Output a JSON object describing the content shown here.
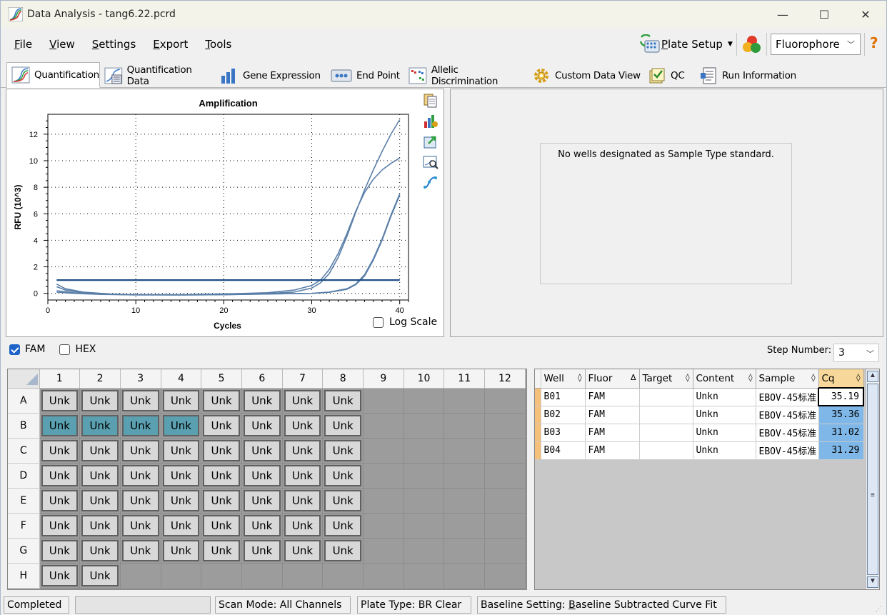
{
  "window": {
    "title": "Data Analysis - tang6.22.pcrd",
    "minimize": "—",
    "maximize": "☐",
    "close": "✕"
  },
  "menu": [
    {
      "pre": "",
      "u": "F",
      "post": "ile"
    },
    {
      "pre": "",
      "u": "V",
      "post": "iew"
    },
    {
      "pre": "",
      "u": "S",
      "post": "ettings"
    },
    {
      "pre": "",
      "u": "E",
      "post": "xport"
    },
    {
      "pre": "",
      "u": "T",
      "post": "ools"
    }
  ],
  "toolbar": {
    "plate_setup_u": "P",
    "plate_setup_rest": "late Setup",
    "fluor_select": "Fluorophore",
    "help": "?"
  },
  "tabs": [
    {
      "label": "Quantification",
      "icon": "amplification-icon"
    },
    {
      "label": "Quantification Data",
      "icon": "quant-data-icon"
    },
    {
      "label": "Gene Expression",
      "icon": "bar-chart-icon"
    },
    {
      "label": "End Point",
      "icon": "end-point-icon"
    },
    {
      "label": "Allelic Discrimination",
      "icon": "scatter-icon"
    },
    {
      "label": "Custom Data View",
      "icon": "gear-icon"
    },
    {
      "label": "QC",
      "icon": "qc-check-icon"
    },
    {
      "label": "Run Information",
      "icon": "report-icon"
    }
  ],
  "chart_data": {
    "type": "line",
    "title": "Amplification",
    "xlabel": "Cycles",
    "ylabel": "RFU (10^3)",
    "xlim": [
      0,
      41
    ],
    "ylim": [
      -0.5,
      13.5
    ],
    "xticks": [
      0,
      10,
      20,
      30,
      40
    ],
    "yticks": [
      0,
      2,
      4,
      6,
      8,
      10,
      12
    ],
    "grid": true,
    "threshold": 1.0,
    "series": [
      {
        "values": [
          [
            1,
            0.2
          ],
          [
            3,
            0.05
          ],
          [
            6,
            -0.05
          ],
          [
            10,
            -0.1
          ],
          [
            15,
            -0.1
          ],
          [
            20,
            -0.05
          ],
          [
            25,
            0.05
          ],
          [
            28,
            0.25
          ],
          [
            30,
            0.6
          ],
          [
            31,
            1.0
          ],
          [
            32,
            1.8
          ],
          [
            33,
            3.0
          ],
          [
            34,
            4.5
          ],
          [
            35,
            6.2
          ],
          [
            36,
            7.6
          ],
          [
            37,
            8.6
          ],
          [
            38,
            9.3
          ],
          [
            39,
            9.8
          ],
          [
            40,
            10.2
          ]
        ]
      },
      {
        "values": [
          [
            1,
            0.1
          ],
          [
            3,
            0.0
          ],
          [
            6,
            -0.08
          ],
          [
            10,
            -0.1
          ],
          [
            15,
            -0.1
          ],
          [
            20,
            -0.05
          ],
          [
            25,
            0.0
          ],
          [
            28,
            0.1
          ],
          [
            30,
            0.4
          ],
          [
            31,
            0.8
          ],
          [
            32,
            1.5
          ],
          [
            33,
            2.7
          ],
          [
            34,
            4.3
          ],
          [
            35,
            6.1
          ],
          [
            36,
            7.8
          ],
          [
            37,
            9.3
          ],
          [
            38,
            10.7
          ],
          [
            39,
            12.0
          ],
          [
            40,
            13.1
          ]
        ]
      },
      {
        "values": [
          [
            1,
            0.7
          ],
          [
            2,
            0.35
          ],
          [
            4,
            0.1
          ],
          [
            7,
            -0.05
          ],
          [
            10,
            -0.1
          ],
          [
            15,
            -0.12
          ],
          [
            20,
            -0.1
          ],
          [
            25,
            -0.05
          ],
          [
            30,
            0.0
          ],
          [
            32,
            0.1
          ],
          [
            34,
            0.35
          ],
          [
            35,
            0.7
          ],
          [
            36,
            1.4
          ],
          [
            37,
            2.6
          ],
          [
            38,
            4.1
          ],
          [
            39,
            5.9
          ],
          [
            40,
            7.5
          ]
        ]
      },
      {
        "values": [
          [
            1,
            0.5
          ],
          [
            2,
            0.25
          ],
          [
            4,
            0.05
          ],
          [
            7,
            -0.08
          ],
          [
            10,
            -0.12
          ],
          [
            15,
            -0.12
          ],
          [
            20,
            -0.1
          ],
          [
            25,
            -0.05
          ],
          [
            30,
            0.0
          ],
          [
            32,
            0.08
          ],
          [
            34,
            0.3
          ],
          [
            35,
            0.65
          ],
          [
            36,
            1.3
          ],
          [
            37,
            2.5
          ],
          [
            38,
            4.0
          ],
          [
            39,
            5.8
          ],
          [
            40,
            7.4
          ]
        ]
      }
    ],
    "line_color": "#5a7fa8",
    "threshold_color": "#1e4e84"
  },
  "chart_options": {
    "log_scale": "Log Scale"
  },
  "std_panel": {
    "message": "No wells designated as Sample Type standard."
  },
  "fluor_filters": [
    {
      "label": "FAM",
      "checked": true
    },
    {
      "label": "HEX",
      "checked": false
    }
  ],
  "step": {
    "label": "Step Number:",
    "value": "3"
  },
  "plate": {
    "cols": [
      "1",
      "2",
      "3",
      "4",
      "5",
      "6",
      "7",
      "8",
      "9",
      "10",
      "11",
      "12"
    ],
    "rows": [
      "A",
      "B",
      "C",
      "D",
      "E",
      "F",
      "G",
      "H"
    ],
    "well_label": "Unk",
    "filled_cols": {
      "A": 8,
      "B": 8,
      "C": 8,
      "D": 8,
      "E": 8,
      "F": 8,
      "G": 8,
      "H": 2
    },
    "selected": {
      "B": [
        1,
        2,
        3,
        4
      ]
    },
    "selected_color": "#5aa0b0"
  },
  "results": {
    "headers": [
      {
        "label": "Well",
        "sort": "◊"
      },
      {
        "label": "Fluor",
        "sort": "Δ"
      },
      {
        "label": "Target",
        "sort": "◊"
      },
      {
        "label": "Content",
        "sort": "◊"
      },
      {
        "label": "Sample",
        "sort": "◊"
      },
      {
        "label": "Cq",
        "sort": "◊"
      }
    ],
    "rows": [
      [
        "B01",
        "FAM",
        "",
        "Unkn",
        "EBOV-45标准",
        "35.19"
      ],
      [
        "B02",
        "FAM",
        "",
        "Unkn",
        "EBOV-45标准",
        "35.36"
      ],
      [
        "B03",
        "FAM",
        "",
        "Unkn",
        "EBOV-45标准",
        "31.02"
      ],
      [
        "B04",
        "FAM",
        "",
        "Unkn",
        "EBOV-45标准",
        "31.29"
      ]
    ]
  },
  "status": {
    "state": "Completed",
    "scan_mode": "Scan Mode: All Channels",
    "plate_type": "Plate Type: BR Clear",
    "baseline_pre": "Baseline Setting: ",
    "baseline_u": "B",
    "baseline_post": "aseline Subtracted Curve Fit"
  }
}
